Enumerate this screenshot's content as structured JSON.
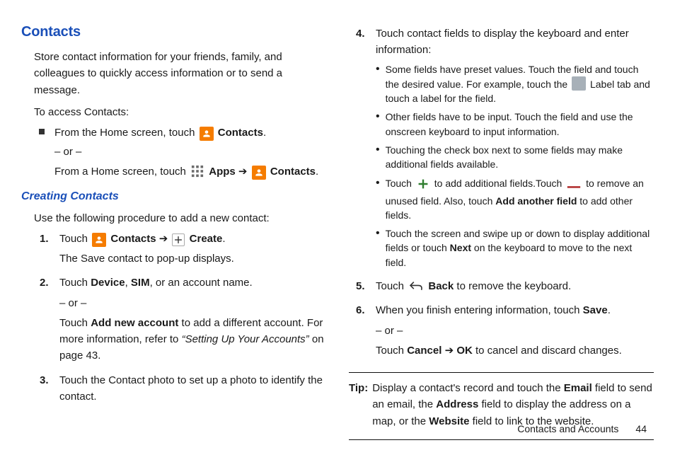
{
  "section_title": "Contacts",
  "intro": "Store contact information for your friends, family, and colleagues to quickly access information or to send a message.",
  "access_label": "To access Contacts:",
  "from_home_pre": "From the Home screen, touch ",
  "contacts_bold": "Contacts",
  "period": ".",
  "or_text": "– or –",
  "from_home2_pre": "From a Home screen, touch ",
  "apps_bold": "Apps",
  "arrow": " ➔ ",
  "subsection_title": "Creating Contacts",
  "sub_intro": "Use the following procedure to add a new contact:",
  "steps_left": [
    {
      "n": "1.",
      "line1_pre": "Touch ",
      "line1_mid": "Contacts",
      "line1_arrow": " ➔ ",
      "line1_create": "Create",
      "line1_end": ".",
      "line2": "The Save contact to pop-up displays."
    },
    {
      "n": "2.",
      "line1_pre": "Touch ",
      "device": "Device",
      "comma": ", ",
      "sim": "SIM",
      "tail": ", or an account name.",
      "or": "– or –",
      "add_pre": "Touch ",
      "add_bold": "Add new account",
      "add_tail": " to add a different account. For more information, refer to ",
      "ref_italic": "“Setting Up Your Accounts”",
      "ref_tail": " on page 43."
    },
    {
      "n": "3.",
      "line": "Touch the Contact photo to set up a photo to identify the contact."
    }
  ],
  "steps_right": [
    {
      "n": "4.",
      "line": "Touch contact fields to display the keyboard and enter information:",
      "bullets": [
        {
          "pre": "Some fields have preset values. Touch the field and touch the desired value. For example, touch the ",
          "suf": " Label tab and touch a label for the field."
        },
        {
          "text": "Other fields have to be input. Touch the field and use the onscreen keyboard to input information."
        },
        {
          "text": "Touching the check box next to some fields may make additional fields available."
        },
        {
          "pre1": "Touch ",
          "mid1": " to add additional fields.Touch ",
          "mid2": " to remove an unused field. Also, touch ",
          "bold": "Add another field",
          "suf": " to add other fields."
        },
        {
          "pre": "Touch the screen and swipe up or down to display additional fields or touch ",
          "bold": "Next",
          "suf": " on the keyboard to move to the next field."
        }
      ]
    },
    {
      "n": "5.",
      "pre": "Touch ",
      "back_bold": "Back",
      "suf": " to remove the keyboard."
    },
    {
      "n": "6.",
      "line1_pre": "When you finish entering information, touch ",
      "save_bold": "Save",
      "period": ".",
      "or": "– or –",
      "cancel_pre": "Touch ",
      "cancel_bold": "Cancel",
      "arrow": " ➔ ",
      "ok_bold": "OK",
      "cancel_suf": " to cancel and discard changes."
    }
  ],
  "tip_label": "Tip:",
  "tip_pre": "Display a contact's record and touch the ",
  "tip_email": "Email",
  "tip_mid1": " field to send an email, the ",
  "tip_address": "Address",
  "tip_mid2": " field to display the address on a map, or the ",
  "tip_website": "Website",
  "tip_suf": " field to link to the website.",
  "footer_section": "Contacts and Accounts",
  "footer_page": "44"
}
